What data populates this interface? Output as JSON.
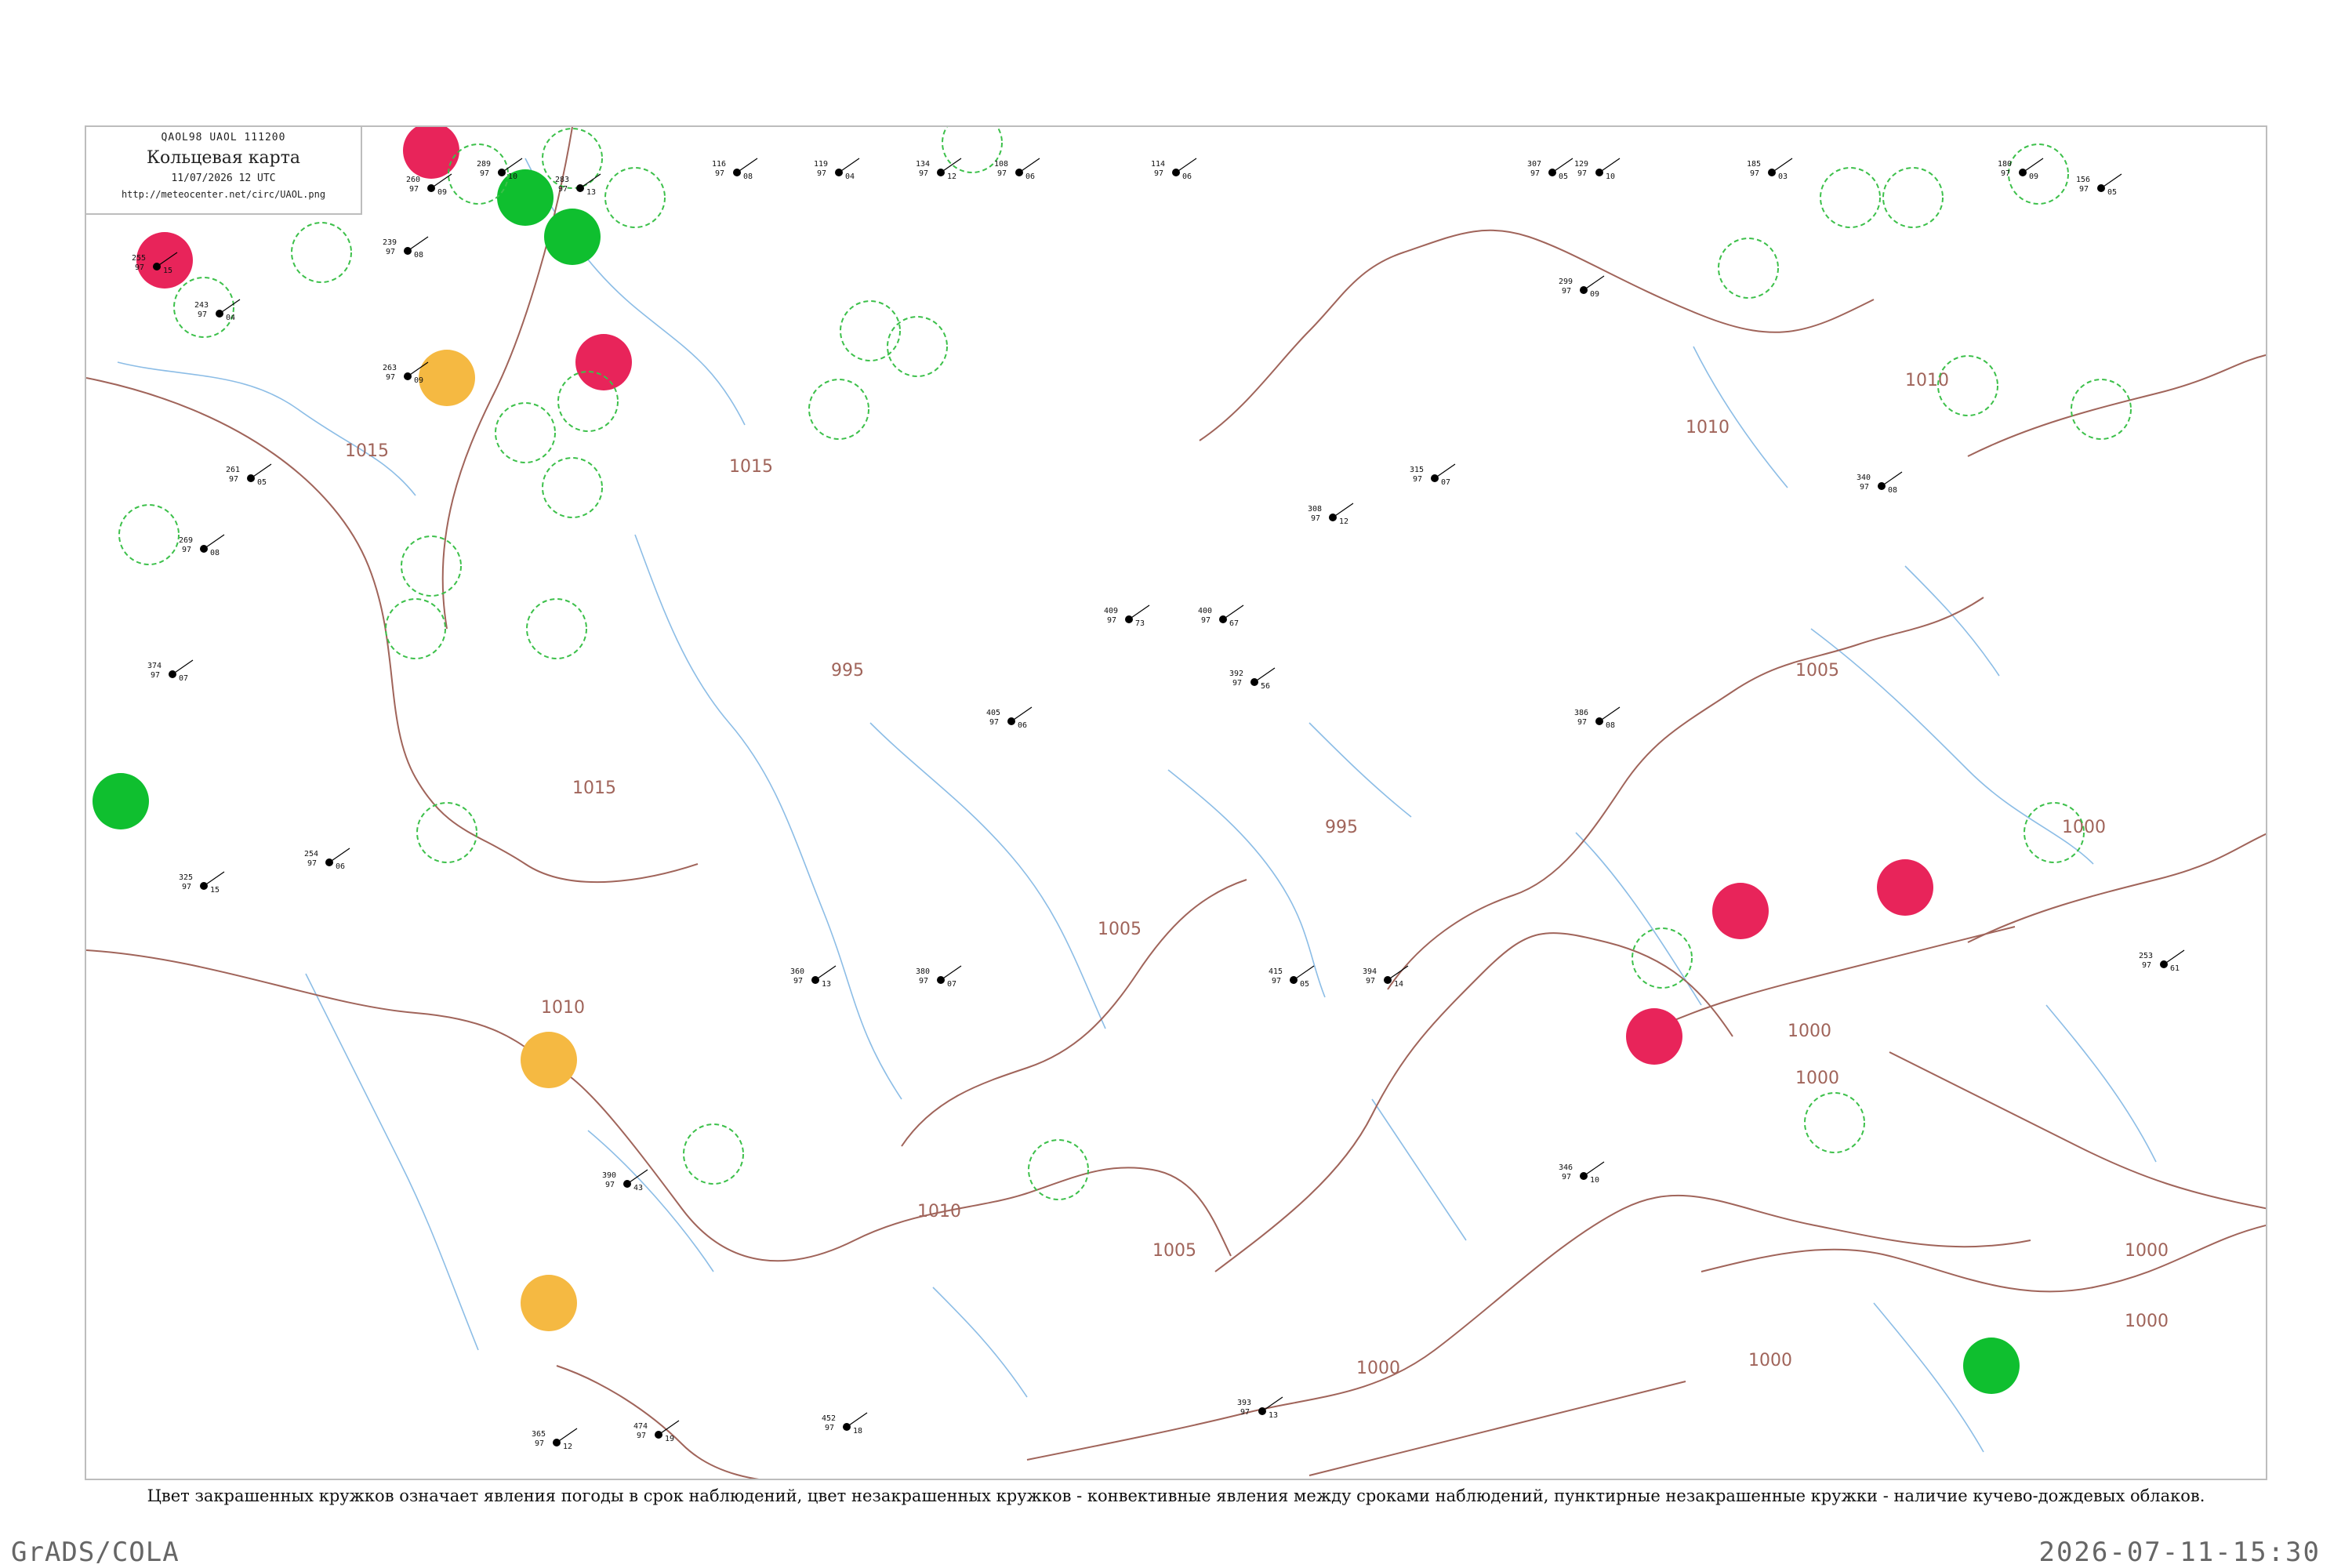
{
  "header": {
    "code": "QAOL98  UAOL  111200",
    "title": "Кольцевая карта",
    "date": "11/07/2026 12 UTC",
    "url": "http://meteocenter.net/circ/UAOL.png"
  },
  "caption": "Цвет закрашенных кружков означает явления погоды в срок наблюдений, цвет незакрашенных кружков - конвективные явления между сроками наблюдений, пунктирные незакрашенные кружки - наличие кучево-дождевых облаков.",
  "footer": {
    "left": "GrADS/COLA",
    "right": "2026-07-11-15:30"
  },
  "colors": {
    "isobar": "#a0645a",
    "water": "#8cbde6",
    "rain_fill": "#e8245a",
    "thunder_fill": "#0fbf2f",
    "haze_fill": "#f5b942",
    "cb_ring": "#3cc04a",
    "station": "#000000"
  },
  "isobars": [
    "1015",
    "1015",
    "1015",
    "1010",
    "1010",
    "1010",
    "1010",
    "1005",
    "1005",
    "1005",
    "1000",
    "1000",
    "1000",
    "1000",
    "1000",
    "1000",
    "1000",
    "995",
    "995"
  ],
  "stations": [
    {
      "pressure": "289",
      "dew": "97",
      "temp": "10"
    },
    {
      "pressure": "260",
      "dew": "97",
      "temp": "09"
    },
    {
      "pressure": "283",
      "dew": "97",
      "temp": "13"
    },
    {
      "pressure": "116",
      "dew": "97",
      "temp": "08"
    },
    {
      "pressure": "119",
      "dew": "97",
      "temp": "04"
    },
    {
      "pressure": "134",
      "dew": "97",
      "temp": "12"
    },
    {
      "pressure": "108",
      "dew": "97",
      "temp": "06"
    },
    {
      "pressure": "114",
      "dew": "97",
      "temp": "06"
    },
    {
      "pressure": "307",
      "dew": "97",
      "temp": "05"
    },
    {
      "pressure": "129",
      "dew": "97",
      "temp": "10"
    },
    {
      "pressure": "185",
      "dew": "97",
      "temp": "03"
    },
    {
      "pressure": "180",
      "dew": "97",
      "temp": "09"
    },
    {
      "pressure": "239",
      "dew": "97",
      "temp": "08"
    },
    {
      "pressure": "255",
      "dew": "97",
      "temp": "15"
    },
    {
      "pressure": "243",
      "dew": "97",
      "temp": "04"
    },
    {
      "pressure": "263",
      "dew": "97",
      "temp": "09"
    },
    {
      "pressure": "261",
      "dew": "97",
      "temp": "05"
    },
    {
      "pressure": "269",
      "dew": "97",
      "temp": "08"
    },
    {
      "pressure": "374",
      "dew": "97",
      "temp": "07"
    },
    {
      "pressure": "325",
      "dew": "97",
      "temp": "15"
    },
    {
      "pressure": "254",
      "dew": "97",
      "temp": "06"
    },
    {
      "pressure": "380",
      "dew": "97",
      "temp": "07"
    },
    {
      "pressure": "409",
      "dew": "97",
      "temp": "73"
    },
    {
      "pressure": "400",
      "dew": "97",
      "temp": "67"
    },
    {
      "pressure": "392",
      "dew": "97",
      "temp": "56"
    },
    {
      "pressure": "360",
      "dew": "97",
      "temp": "13"
    },
    {
      "pressure": "390",
      "dew": "97",
      "temp": "43"
    },
    {
      "pressure": "346",
      "dew": "97",
      "temp": "10"
    },
    {
      "pressure": "415",
      "dew": "97",
      "temp": "05"
    },
    {
      "pressure": "394",
      "dew": "97",
      "temp": "14"
    },
    {
      "pressure": "452",
      "dew": "97",
      "temp": "18"
    },
    {
      "pressure": "393",
      "dew": "97",
      "temp": "13"
    },
    {
      "pressure": "474",
      "dew": "97",
      "temp": "19"
    },
    {
      "pressure": "365",
      "dew": "97",
      "temp": "12"
    },
    {
      "pressure": "156",
      "dew": "97",
      "temp": "05"
    },
    {
      "pressure": "253",
      "dew": "97",
      "temp": "61"
    },
    {
      "pressure": "308",
      "dew": "97",
      "temp": "12"
    },
    {
      "pressure": "315",
      "dew": "97",
      "temp": "07"
    },
    {
      "pressure": "299",
      "dew": "97",
      "temp": "09"
    },
    {
      "pressure": "340",
      "dew": "97",
      "temp": "08"
    },
    {
      "pressure": "405",
      "dew": "97",
      "temp": "06"
    },
    {
      "pressure": "386",
      "dew": "97",
      "temp": "08"
    }
  ]
}
